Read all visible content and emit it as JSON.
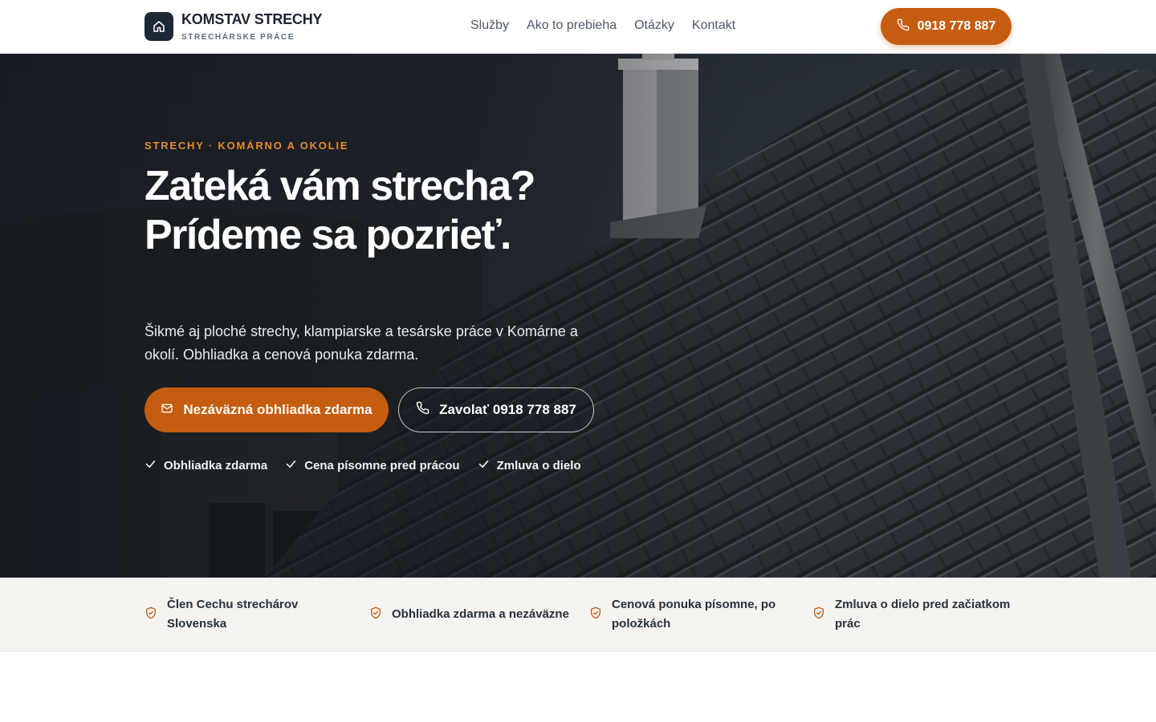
{
  "header": {
    "logo_title": "KOMSTAV STRECHY",
    "logo_subtitle": "STRECHÁRSKE PRÁCE",
    "nav": [
      {
        "label": "Služby"
      },
      {
        "label": "Ako to prebieha"
      },
      {
        "label": "Otázky"
      },
      {
        "label": "Kontakt"
      }
    ],
    "phone_label": "0918 778 887"
  },
  "hero": {
    "eyebrow": "STRECHY · KOMÁRNO A OKOLIE",
    "title": "Zateká vám strecha? Prídeme sa pozrieť.",
    "description": "Šikmé aj ploché strechy, klampiarske a tesárske práce v Komárne a okolí. Obhliadka a cenová ponuka zdarma.",
    "cta_primary": "Nezáväzná obhliadka zdarma",
    "cta_secondary": "Zavolať 0918 778 887",
    "checks": [
      {
        "label": "Obhliadka zdarma"
      },
      {
        "label": "Cena písomne pred prácou"
      },
      {
        "label": "Zmluva o dielo"
      }
    ]
  },
  "trust": {
    "items": [
      {
        "label": "Člen Cechu strechárov Slovenska"
      },
      {
        "label": "Obhliadka zdarma a nezáväzne"
      },
      {
        "label": "Cenová ponuka písomne, po položkách"
      },
      {
        "label": "Zmluva o dielo pred začiatkom prác"
      }
    ]
  },
  "colors": {
    "accent": "#c45d0f",
    "eyebrow": "#e58a2e",
    "logo_bg": "#1c2737",
    "strip_bg": "#f5f4f1"
  }
}
